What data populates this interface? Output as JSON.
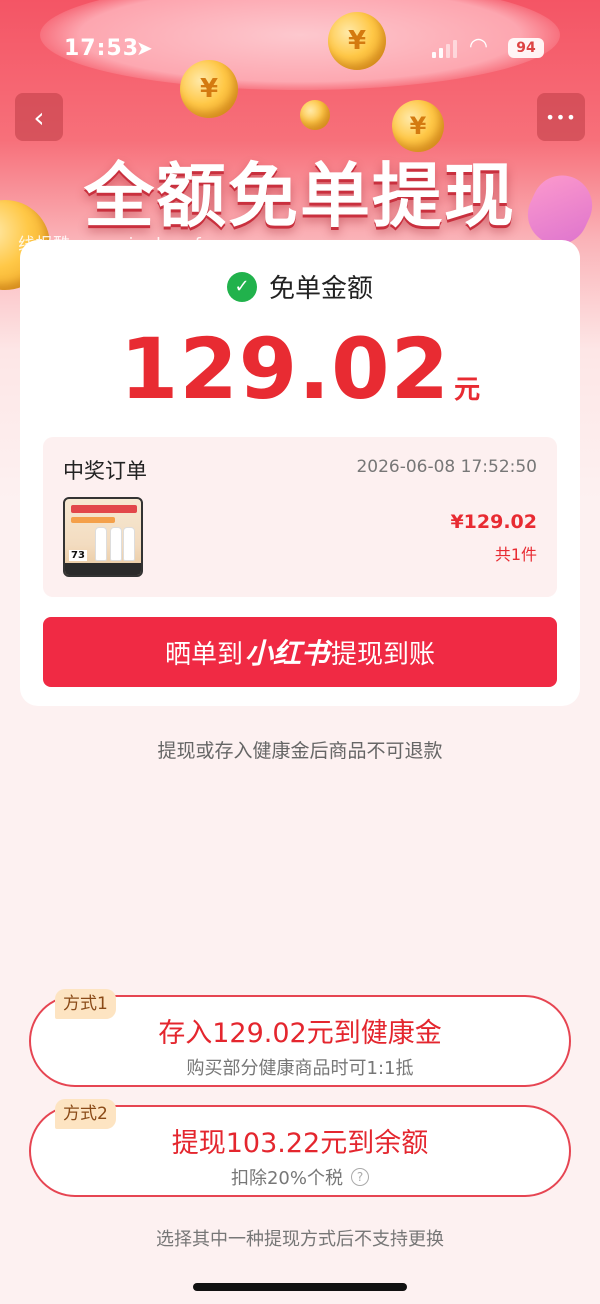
{
  "status_bar": {
    "time": "17:53",
    "battery": "94"
  },
  "header": {
    "title": "全额免单提现",
    "watermark": "线报酷-new.xianbao.fun",
    "back_icon": "‹",
    "more_icon": "•••"
  },
  "card": {
    "check_label": "免单金额",
    "amount": "129.02",
    "amount_unit": "元",
    "order": {
      "label": "中奖订单",
      "time": "2026-06-08 17:52:50",
      "thumb_tag": "73",
      "price": "¥129.02",
      "count": "共1件"
    },
    "share_button": {
      "prefix": "晒单到",
      "brand": "小红书",
      "suffix": "提现到账"
    }
  },
  "notice": "提现或存入健康金后商品不可退款",
  "options": [
    {
      "badge": "方式1",
      "main": "存入129.02元到健康金",
      "sub": "购买部分健康商品时可1:1抵"
    },
    {
      "badge": "方式2",
      "main": "提现103.22元到余额",
      "sub": "扣除20%个税"
    }
  ],
  "footnote": "选择其中一种提现方式后不支持更换",
  "colors": {
    "accent": "#f02a44",
    "amount_red": "#e82b32",
    "check_green": "#21b24c"
  }
}
